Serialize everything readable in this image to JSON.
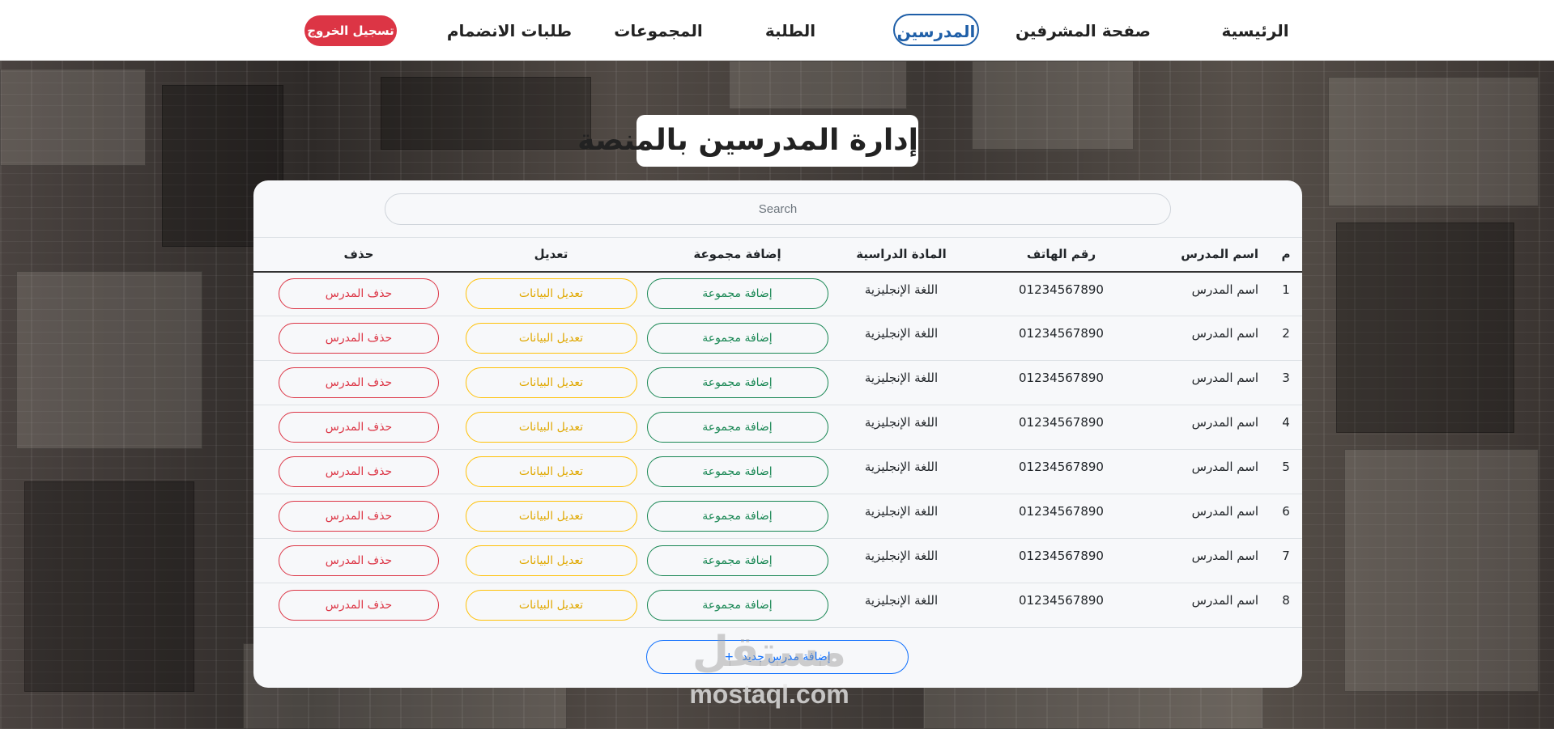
{
  "nav": {
    "items": [
      {
        "label": "الرئيسية"
      },
      {
        "label": "صفحة المشرفين"
      },
      {
        "label": "المدرسين"
      },
      {
        "label": "الطلبة"
      },
      {
        "label": "المجموعات"
      },
      {
        "label": "طلبات الانضمام"
      }
    ],
    "active": "المدرسين",
    "logout_label": "تسجيل الخروج"
  },
  "page": {
    "title": "إدارة المدرسين بالمنصة"
  },
  "search": {
    "placeholder": "Search",
    "value": ""
  },
  "table": {
    "columns": [
      "م",
      "اسم المدرس",
      "رقم الهاتف",
      "المادة الدراسية",
      "إضافة مجموعة",
      "تعديل",
      "حذف"
    ],
    "rows": [
      {
        "num": "1",
        "name": "اسم المدرس",
        "phone": "01234567890",
        "subject": "اللغة الإنجليزية",
        "add_group": "إضافة مجموعة",
        "edit": "تعديل البيانات",
        "delete": "حذف المدرس"
      },
      {
        "num": "2",
        "name": "اسم المدرس",
        "phone": "01234567890",
        "subject": "اللغة الإنجليزية",
        "add_group": "إضافة مجموعة",
        "edit": "تعديل البيانات",
        "delete": "حذف المدرس"
      },
      {
        "num": "3",
        "name": "اسم المدرس",
        "phone": "01234567890",
        "subject": "اللغة الإنجليزية",
        "add_group": "إضافة مجموعة",
        "edit": "تعديل البيانات",
        "delete": "حذف المدرس"
      },
      {
        "num": "4",
        "name": "اسم المدرس",
        "phone": "01234567890",
        "subject": "اللغة الإنجليزية",
        "add_group": "إضافة مجموعة",
        "edit": "تعديل البيانات",
        "delete": "حذف المدرس"
      },
      {
        "num": "5",
        "name": "اسم المدرس",
        "phone": "01234567890",
        "subject": "اللغة الإنجليزية",
        "add_group": "إضافة مجموعة",
        "edit": "تعديل البيانات",
        "delete": "حذف المدرس"
      },
      {
        "num": "6",
        "name": "اسم المدرس",
        "phone": "01234567890",
        "subject": "اللغة الإنجليزية",
        "add_group": "إضافة مجموعة",
        "edit": "تعديل البيانات",
        "delete": "حذف المدرس"
      },
      {
        "num": "7",
        "name": "اسم المدرس",
        "phone": "01234567890",
        "subject": "اللغة الإنجليزية",
        "add_group": "إضافة مجموعة",
        "edit": "تعديل البيانات",
        "delete": "حذف المدرس"
      },
      {
        "num": "8",
        "name": "اسم المدرس",
        "phone": "01234567890",
        "subject": "اللغة الإنجليزية",
        "add_group": "إضافة مجموعة",
        "edit": "تعديل البيانات",
        "delete": "حذف المدرس"
      }
    ]
  },
  "add_teacher": {
    "icon": "+",
    "label": "إضافة مدرس جديد"
  },
  "watermark": {
    "arabic": "مستقل",
    "latin": "mostaql.com"
  },
  "colors": {
    "active_nav": "#1f5fa8",
    "logout": "#dc3545",
    "add_group": "#198754",
    "edit": "#ffc107",
    "delete": "#dc3545",
    "add_teacher": "#0d6efd"
  }
}
